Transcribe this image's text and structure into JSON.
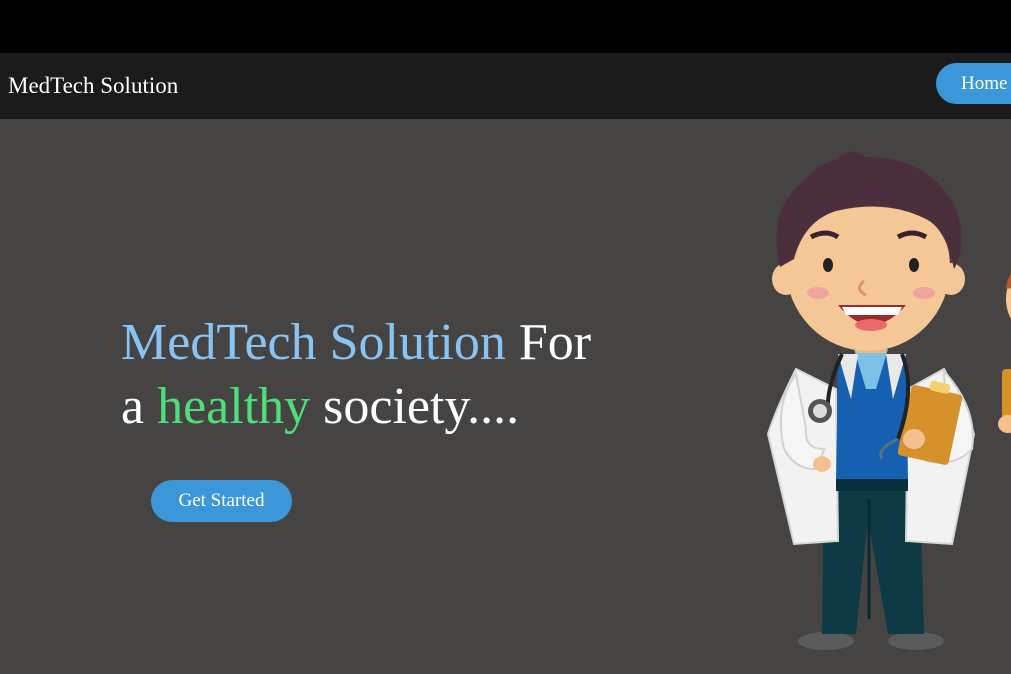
{
  "navbar": {
    "brand": "MedTech Solution",
    "home_label": "Home"
  },
  "hero": {
    "line1_highlight": "MedTech Solution",
    "line1_rest": " For",
    "line2_start": "a ",
    "line2_highlight": "healthy",
    "line2_rest": " society....",
    "cta_label": "Get Started"
  },
  "colors": {
    "accent_blue": "#3b97d8",
    "highlight_blue": "#88c4f3",
    "highlight_green": "#4de07a",
    "hero_bg": "#464443",
    "navbar_bg": "#1b1b1b"
  },
  "images": {
    "illustration": "cartoon-doctor-illustration"
  }
}
